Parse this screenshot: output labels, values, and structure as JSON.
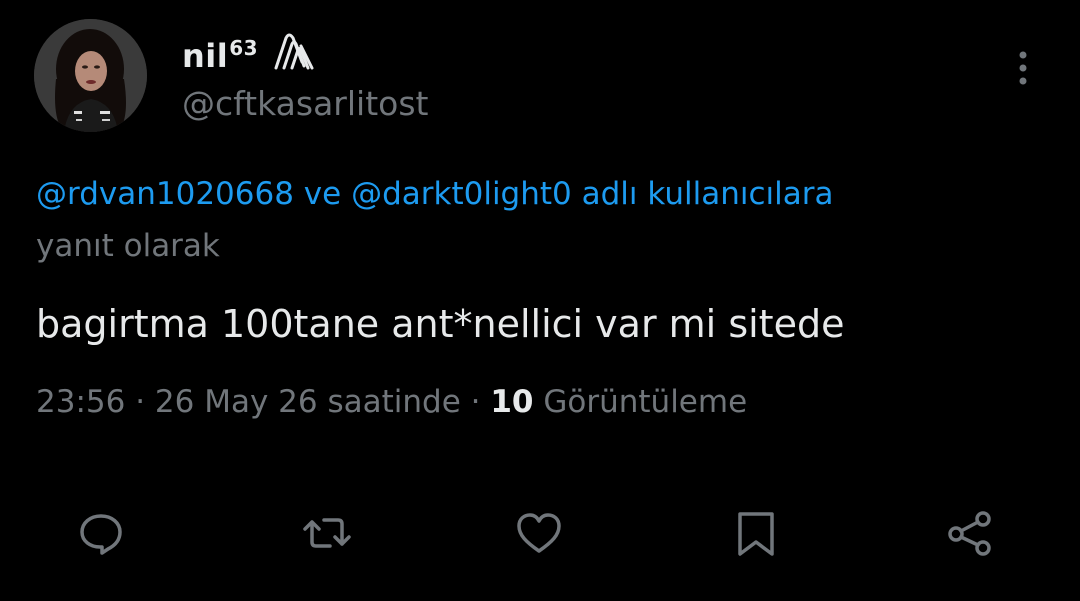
{
  "author": {
    "display_name": "nil",
    "display_name_sup": "63",
    "handle": "@cftkasarlitost"
  },
  "reply_context": {
    "mention_1": "@rdvan1020668",
    "connector": "ve",
    "mention_2": "@darkt0light0",
    "suffix_line1": "adlı kullanıcılara",
    "suffix_line2": "yanıt olarak"
  },
  "tweet": {
    "text": "bagirtma 100tane ant*nellici var mi sitede"
  },
  "meta": {
    "time": "23:56",
    "separator": "·",
    "date_text": "26 May 26 saatinde",
    "views_count": "10",
    "views_label": "Görüntüleme"
  },
  "actions": {
    "icons": [
      "reply-icon",
      "retweet-icon",
      "like-icon",
      "bookmark-icon",
      "share-icon"
    ]
  },
  "colors": {
    "background": "#000000",
    "primary_text": "#e7e9ea",
    "secondary_text": "#71767b",
    "accent": "#1d9bf0"
  }
}
